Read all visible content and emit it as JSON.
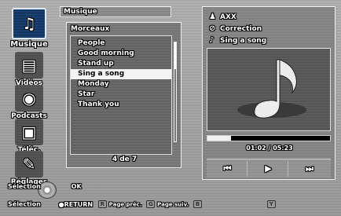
{
  "sidebar": {
    "items": [
      {
        "label": "Musique",
        "icon": "music-note-icon",
        "active": true
      },
      {
        "label": "Vidéos",
        "icon": "film-icon"
      },
      {
        "label": "Podcasts",
        "icon": "speaker-icon"
      },
      {
        "label": "Téléc.",
        "icon": "download-icon"
      },
      {
        "label": "Réglages",
        "icon": "wrench-icon"
      }
    ]
  },
  "breadcrumb": "Musique",
  "list": {
    "title": "Morceaux",
    "items": [
      "People",
      "Good morning",
      "Stand up",
      "Sing a song",
      "Monday",
      "Star",
      "Thank you"
    ],
    "selected_index": 3,
    "page_label": "4 de 7"
  },
  "now_playing": {
    "artist": "AXX",
    "album": "Correction",
    "track": "Sing a song",
    "time": "01:02 / 05:23",
    "progress": 0.19,
    "controls": {
      "prev": "⏮",
      "play": "▶",
      "next": "⏭"
    }
  },
  "footer": {
    "select_ok_label": "Sélection",
    "ok_text": "OK",
    "select_return_label": "Sélection",
    "return_text": "●RETURN",
    "key_r": "R",
    "prev_page": "Page préc.",
    "key_g": "G",
    "next_page": "Page suiv.",
    "key_b": "B",
    "key_y": "Y"
  }
}
